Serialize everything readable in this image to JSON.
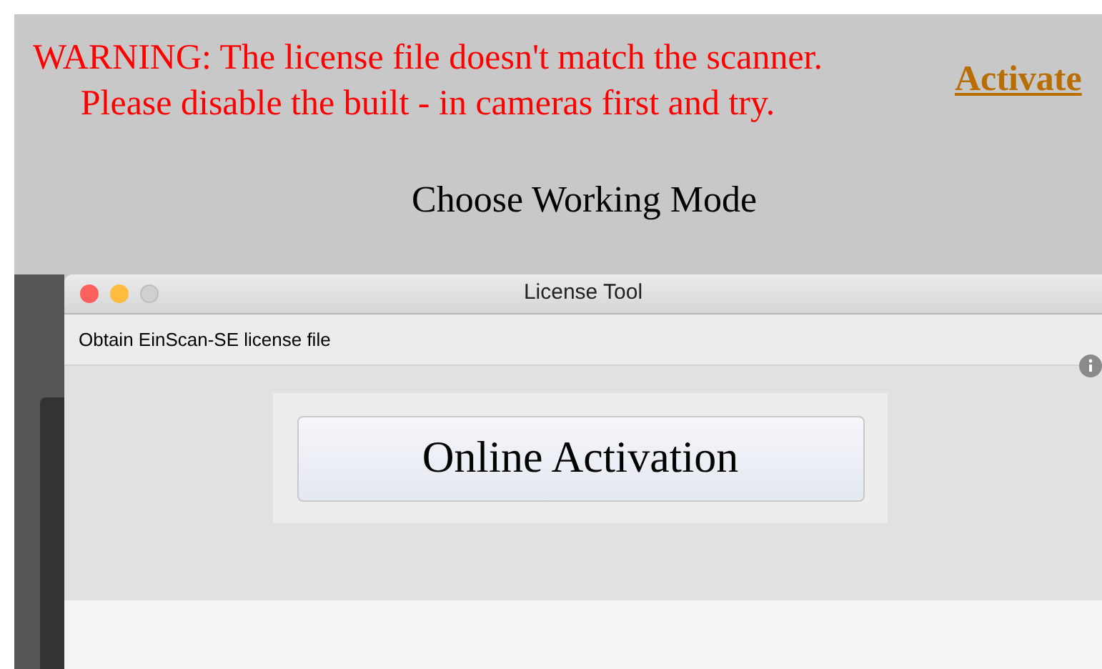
{
  "warning": {
    "lines": [
      "WARNING: The license file doesn't match the scanner.",
      "Please disable the built - in cameras first and try."
    ]
  },
  "activate_link": "Activate",
  "heading": "Choose Working Mode",
  "window": {
    "title": "License Tool",
    "subtitle": "Obtain EinScan-SE license file",
    "button": "Online Activation"
  }
}
